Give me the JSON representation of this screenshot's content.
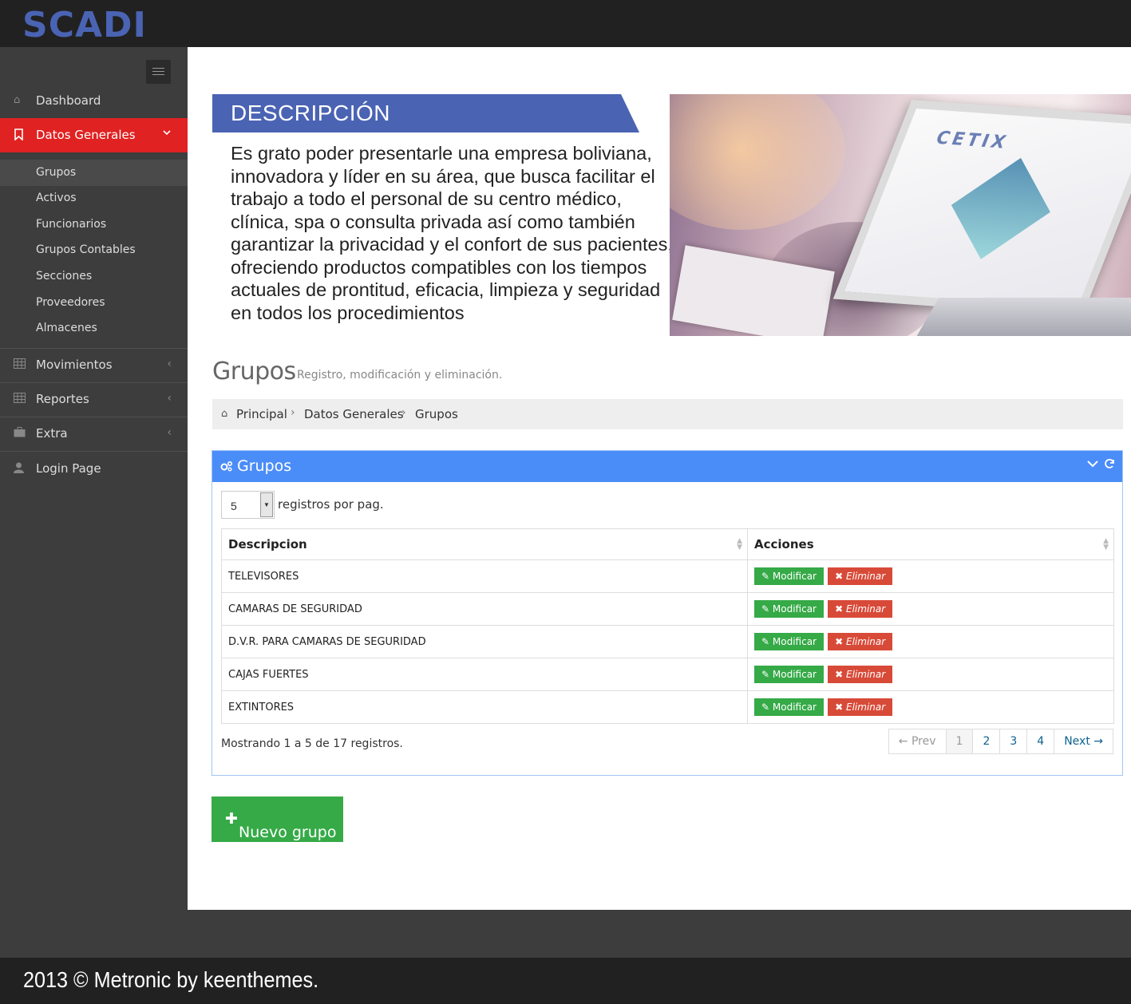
{
  "app": {
    "logo": "SCADI"
  },
  "sidebar": {
    "items": [
      {
        "label": "Dashboard",
        "icon": "home-icon"
      },
      {
        "label": "Datos Generales",
        "icon": "bookmark-icon"
      },
      {
        "label": "Movimientos",
        "icon": "table-icon"
      },
      {
        "label": "Reportes",
        "icon": "table-icon"
      },
      {
        "label": "Extra",
        "icon": "briefcase-icon"
      },
      {
        "label": "Login Page",
        "icon": "user-icon"
      }
    ],
    "subitems": [
      "Grupos",
      "Activos",
      "Funcionarios",
      "Grupos Contables",
      "Secciones",
      "Proveedores",
      "Almacenes"
    ]
  },
  "description": {
    "title": "DESCRIPCIÓN",
    "text": "Es grato poder presentarle una empresa boliviana, innovadora y líder en su área, que busca facilitar el trabajo a todo el personal de su centro médico, clínica, spa o consulta privada así como también garantizar la privacidad y el confort de sus pacientes, ofreciendo productos compatibles con los tiempos actuales de prontitud, eficacia, limpieza y seguridad en todos los procedimientos",
    "image_brand": "CETIX"
  },
  "page": {
    "title": "Grupos",
    "subtitle": "Registro, modificación y eliminación."
  },
  "breadcrumb": [
    "Principal",
    "Datos Generales",
    "Grupos"
  ],
  "portlet": {
    "title": "Grupos",
    "per_page_value": "5",
    "per_page_label": "registros por pag.",
    "columns": [
      "Descripcion",
      "Acciones"
    ],
    "rows": [
      "TELEVISORES",
      "CAMARAS DE SEGURIDAD",
      "D.V.R. PARA CAMARAS DE SEGURIDAD",
      "CAJAS FUERTES",
      "EXTINTORES"
    ],
    "modify_label": "Modificar",
    "delete_label": "Eliminar",
    "info": "Mostrando 1 a 5 de 17 registros.",
    "pager": {
      "prev": "← Prev",
      "pages": [
        "1",
        "2",
        "3",
        "4"
      ],
      "current": "1",
      "next": "Next →"
    }
  },
  "new_button": "Nuevo grupo",
  "footer": "2013 © Metronic by keenthemes.",
  "colors": {
    "header_bg": "#212121",
    "sidebar_bg": "#3d3d3d",
    "active_red": "#e02222",
    "portlet_blue": "#4b8df8",
    "ribbon_blue": "#4a63b3",
    "success_green": "#35aa47",
    "danger_red": "#d84a38"
  }
}
